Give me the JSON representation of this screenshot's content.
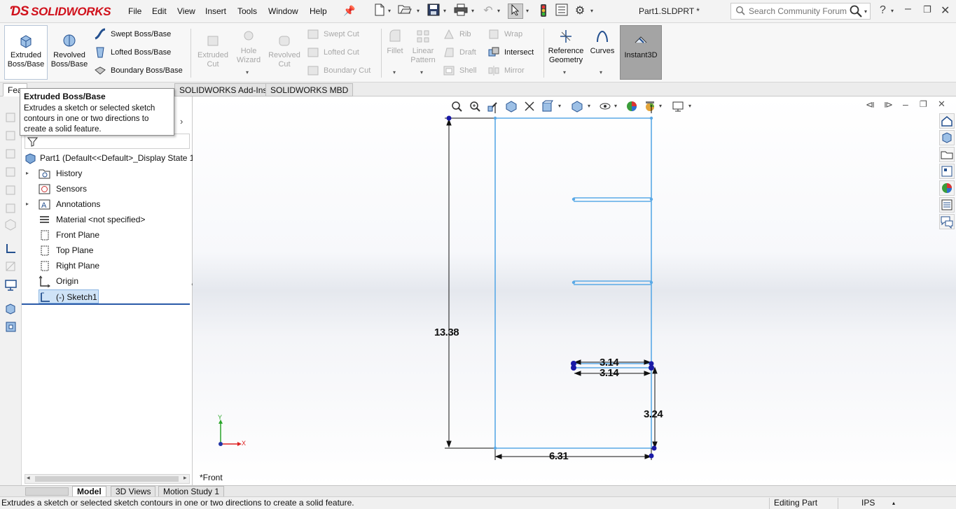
{
  "app": {
    "logo_text": "SOLIDWORKS",
    "document_title": "Part1.SLDPRT *"
  },
  "menu": [
    "File",
    "Edit",
    "View",
    "Insert",
    "Tools",
    "Window",
    "Help"
  ],
  "search": {
    "placeholder": "Search Community Forum"
  },
  "ribbon": {
    "extruded_boss": "Extruded\nBoss/Base",
    "revolved_boss": "Revolved\nBoss/Base",
    "swept_boss": "Swept Boss/Base",
    "lofted_boss": "Lofted Boss/Base",
    "boundary_boss": "Boundary Boss/Base",
    "extruded_cut": "Extruded\nCut",
    "hole_wizard": "Hole\nWizard",
    "revolved_cut": "Revolved\nCut",
    "swept_cut": "Swept Cut",
    "lofted_cut": "Lofted Cut",
    "boundary_cut": "Boundary Cut",
    "fillet": "Fillet",
    "linear_pattern": "Linear\nPattern",
    "rib": "Rib",
    "draft": "Draft",
    "shell": "Shell",
    "wrap": "Wrap",
    "intersect": "Intersect",
    "mirror": "Mirror",
    "reference_geometry": "Reference\nGeometry",
    "curves": "Curves",
    "instant3d": "Instant3D"
  },
  "command_tabs": {
    "features": "Fea",
    "addins": "SOLIDWORKS Add-Ins",
    "mbd": "SOLIDWORKS MBD"
  },
  "tooltip": {
    "title": "Extruded Boss/Base",
    "body": "Extrudes a sketch or selected sketch contours in one or two directions to create a solid feature."
  },
  "feature_tree": {
    "root": "Part1  (Default<<Default>_Display State 1",
    "items": [
      {
        "label": "History",
        "icon": "history-icon"
      },
      {
        "label": "Sensors",
        "icon": "sensors-icon"
      },
      {
        "label": "Annotations",
        "icon": "annotations-icon"
      },
      {
        "label": "Material <not specified>",
        "icon": "material-icon"
      },
      {
        "label": "Front Plane",
        "icon": "plane-icon"
      },
      {
        "label": "Top Plane",
        "icon": "plane-icon"
      },
      {
        "label": "Right Plane",
        "icon": "plane-icon"
      },
      {
        "label": "Origin",
        "icon": "origin-icon"
      },
      {
        "label": "(-) Sketch1",
        "icon": "sketch-icon"
      }
    ]
  },
  "sketch": {
    "dim_height": "13.38",
    "dim_width": "6.31",
    "dim_slot1": "3.14",
    "dim_slot2": "3.14",
    "dim_notch": "3.24"
  },
  "view_label": "*Front",
  "triad": {
    "x": "X",
    "y": "Y"
  },
  "bottom_tabs": [
    "Model",
    "3D Views",
    "Motion Study 1"
  ],
  "status": {
    "message": "Extrudes a sketch or selected sketch contours in one or two directions to create a solid feature.",
    "mode": "Editing Part",
    "units": "IPS"
  },
  "colors": {
    "sketch_blue": "#5aa9e6",
    "point_navy": "#1a1aa6",
    "brand_red": "#d0101b"
  }
}
